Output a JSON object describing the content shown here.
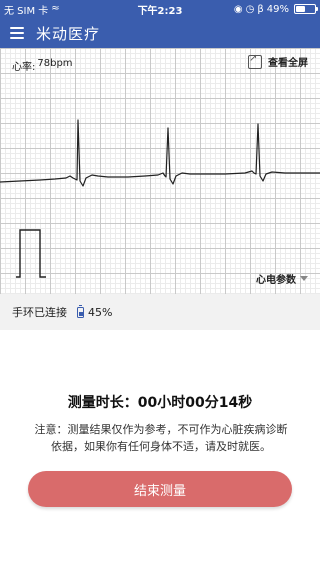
{
  "status_bar": {
    "carrier": "无 SIM 卡",
    "time": "下午2:23",
    "battery_percent_text": "49%",
    "battery_level": 0.49,
    "icons": [
      "wifi-icon",
      "orientation-lock-icon",
      "alarm-icon",
      "bluetooth-icon",
      "battery-icon"
    ]
  },
  "app_bar": {
    "title": "米动医疗",
    "menu_icon": "menu-icon"
  },
  "ecg": {
    "heart_rate_label": "心率:",
    "heart_rate_value": "78bpm",
    "fullscreen_label": "查看全屏",
    "params_label": "心电参数",
    "colors": {
      "trace": "#222222",
      "grid_major": "#c9c9c9",
      "grid_minor": "#ebebeb"
    }
  },
  "device": {
    "connection_status": "手环已连接",
    "battery_text": "45%",
    "battery_level": 0.45
  },
  "measurement": {
    "duration_text": "测量时长：00小时00分14秒",
    "notice_text": "注意：测量结果仅作为参考，不可作为心脏疾病诊断依据，如果你有任何身体不适，请及时就医。",
    "end_button_label": "结束测量"
  },
  "colors": {
    "primary": "#3a5dae",
    "end_button": "#d96b6b",
    "device_row_bg": "#f2f2f2"
  }
}
